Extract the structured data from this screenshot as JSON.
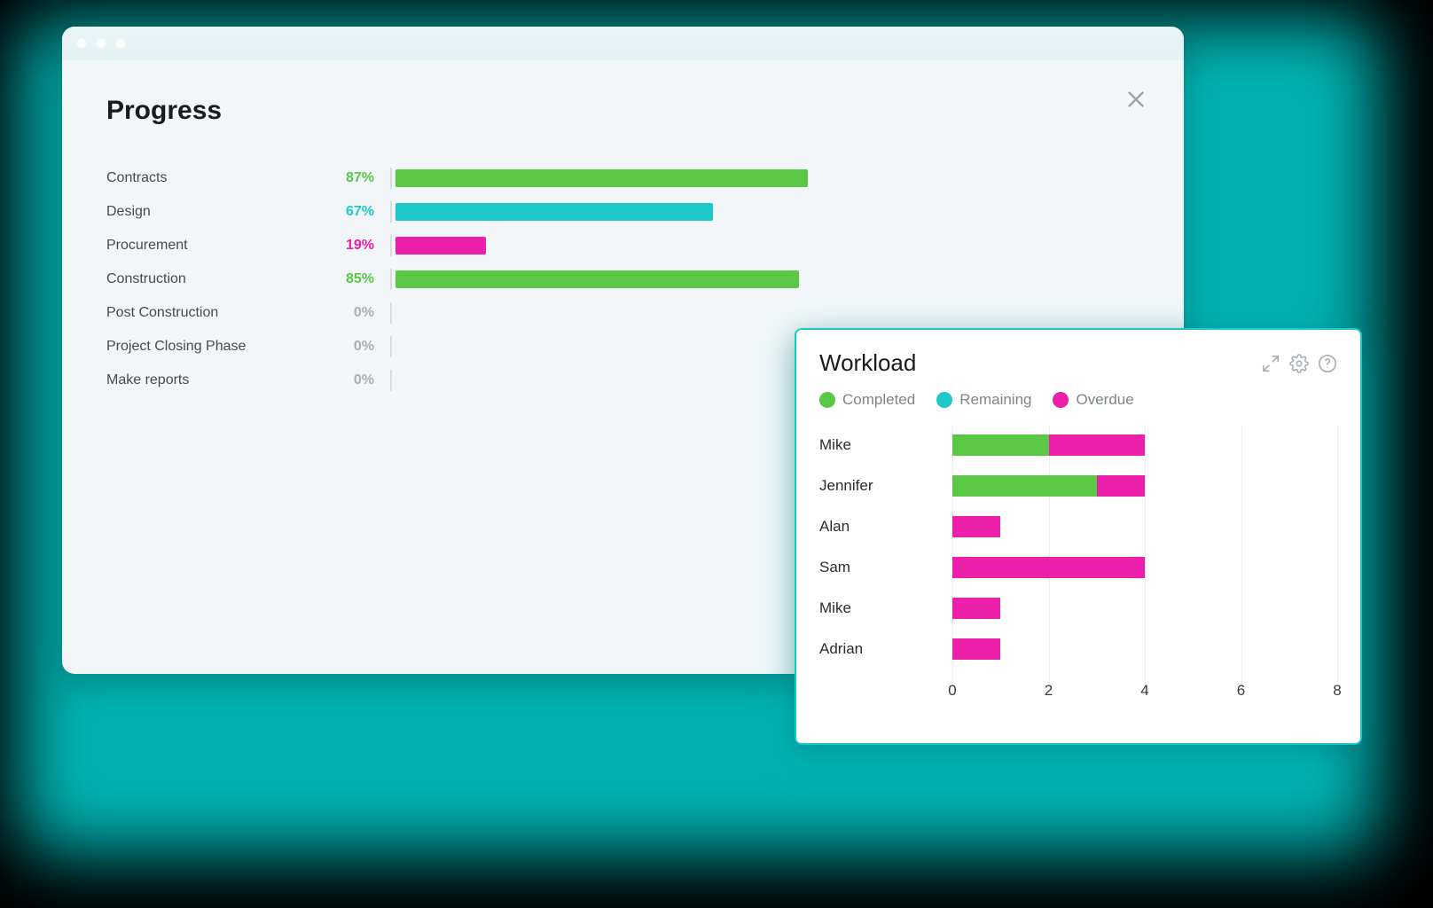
{
  "colors": {
    "green": "#5bc845",
    "cyan": "#1fc8c8",
    "magenta": "#ec1faa",
    "grey": "#a9afb4"
  },
  "progress": {
    "title": "Progress",
    "max": 100,
    "rows": [
      {
        "label": "Contracts",
        "pct": 87,
        "color": "green"
      },
      {
        "label": "Design",
        "pct": 67,
        "color": "cyan"
      },
      {
        "label": "Procurement",
        "pct": 19,
        "color": "magenta"
      },
      {
        "label": "Construction",
        "pct": 85,
        "color": "green"
      },
      {
        "label": "Post Construction",
        "pct": 0,
        "color": "grey"
      },
      {
        "label": "Project Closing Phase",
        "pct": 0,
        "color": "grey"
      },
      {
        "label": "Make reports",
        "pct": 0,
        "color": "grey"
      }
    ]
  },
  "workload": {
    "title": "Workload",
    "legend": [
      {
        "key": "completed",
        "label": "Completed",
        "color": "green"
      },
      {
        "key": "remaining",
        "label": "Remaining",
        "color": "cyan"
      },
      {
        "key": "overdue",
        "label": "Overdue",
        "color": "magenta"
      }
    ],
    "xmax": 8,
    "xticks": [
      0,
      2,
      4,
      6,
      8
    ],
    "rows": [
      {
        "name": "Mike",
        "segments": [
          {
            "key": "completed",
            "value": 2
          },
          {
            "key": "overdue",
            "value": 2
          }
        ]
      },
      {
        "name": "Jennifer",
        "segments": [
          {
            "key": "completed",
            "value": 3
          },
          {
            "key": "overdue",
            "value": 1
          }
        ]
      },
      {
        "name": "Alan",
        "segments": [
          {
            "key": "overdue",
            "value": 1
          }
        ]
      },
      {
        "name": "Sam",
        "segments": [
          {
            "key": "overdue",
            "value": 4
          }
        ]
      },
      {
        "name": "Mike",
        "segments": [
          {
            "key": "overdue",
            "value": 1
          }
        ]
      },
      {
        "name": "Adrian",
        "segments": [
          {
            "key": "overdue",
            "value": 1
          }
        ]
      }
    ]
  },
  "chart_data": [
    {
      "type": "bar",
      "title": "Progress",
      "orientation": "horizontal",
      "xlabel": "",
      "ylabel": "",
      "xlim": [
        0,
        100
      ],
      "unit": "%",
      "categories": [
        "Contracts",
        "Design",
        "Procurement",
        "Construction",
        "Post Construction",
        "Project Closing Phase",
        "Make reports"
      ],
      "values": [
        87,
        67,
        19,
        85,
        0,
        0,
        0
      ]
    },
    {
      "type": "bar",
      "title": "Workload",
      "orientation": "horizontal",
      "stacked": true,
      "xlabel": "",
      "ylabel": "",
      "xlim": [
        0,
        8
      ],
      "xticks": [
        0,
        2,
        4,
        6,
        8
      ],
      "categories": [
        "Mike",
        "Jennifer",
        "Alan",
        "Sam",
        "Mike",
        "Adrian"
      ],
      "series": [
        {
          "name": "Completed",
          "values": [
            2,
            3,
            0,
            0,
            0,
            0
          ]
        },
        {
          "name": "Remaining",
          "values": [
            0,
            0,
            0,
            0,
            0,
            0
          ]
        },
        {
          "name": "Overdue",
          "values": [
            2,
            1,
            1,
            4,
            1,
            1
          ]
        }
      ]
    }
  ]
}
